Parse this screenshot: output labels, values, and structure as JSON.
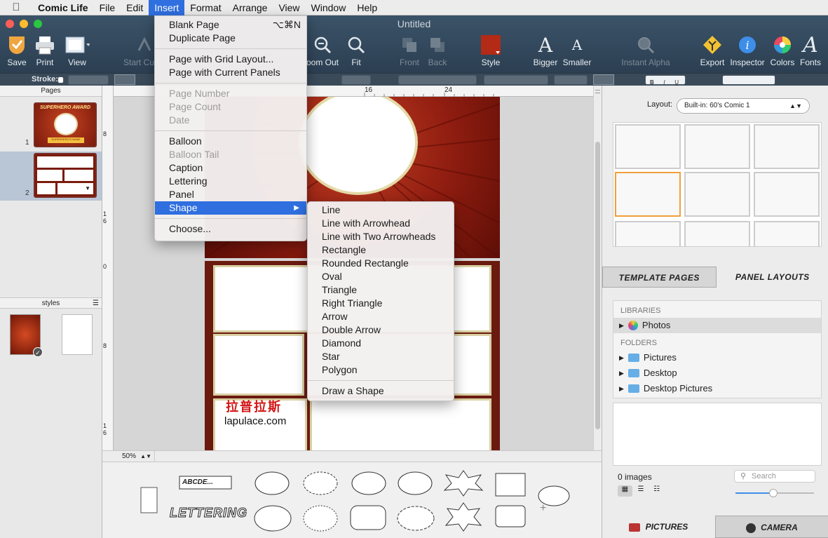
{
  "menubar": {
    "app": "Comic Life",
    "items": [
      "File",
      "Edit",
      "Insert",
      "Format",
      "Arrange",
      "View",
      "Window",
      "Help"
    ]
  },
  "window": {
    "title": "Untitled"
  },
  "toolbar": {
    "save": "Save",
    "print": "Print",
    "view": "View",
    "start": "Start Cu",
    "zoom_out": "oom Out",
    "fit": "Fit",
    "front": "Front",
    "back": "Back",
    "style": "Style",
    "bigger": "Bigger",
    "smaller": "Smaller",
    "instant_alpha": "Instant Alpha",
    "export": "Export",
    "inspector": "Inspector",
    "colors": "Colors",
    "fonts": "Fonts"
  },
  "format_bar": {
    "stroke_label": "Stroke:"
  },
  "sidebar": {
    "pages_header": "Pages",
    "pages": [
      {
        "num": "1",
        "title": "SUPERHERO AWARD",
        "sub": "SUPERHERO'S NAME"
      },
      {
        "num": "2"
      }
    ],
    "styles_header": "styles"
  },
  "ruler": {
    "h_ticks": [
      "16",
      "24"
    ],
    "v_ticks": [
      "8",
      "1\n6",
      "0",
      "8",
      "1\n6"
    ]
  },
  "zoom": {
    "value": "50%"
  },
  "watermark": {
    "cn": "拉普拉斯",
    "url": "lapulace.com"
  },
  "balloons": {
    "caption_text": "ABCDE...",
    "lettering_text": "LETTERING"
  },
  "insert_menu": {
    "groups": [
      [
        {
          "label": "Blank Page",
          "shortcut": "⌥⌘N"
        },
        {
          "label": "Duplicate Page"
        }
      ],
      [
        {
          "label": "Page with Grid Layout..."
        },
        {
          "label": "Page with Current Panels"
        }
      ],
      [
        {
          "label": "Page Number",
          "disabled": true
        },
        {
          "label": "Page Count",
          "disabled": true
        },
        {
          "label": "Date",
          "disabled": true
        }
      ],
      [
        {
          "label": "Balloon"
        },
        {
          "label": "Balloon Tail",
          "disabled": true
        },
        {
          "label": "Caption"
        },
        {
          "label": "Lettering"
        },
        {
          "label": "Panel"
        },
        {
          "label": "Shape",
          "highlighted": true,
          "submenu": true
        }
      ],
      [
        {
          "label": "Choose..."
        }
      ]
    ]
  },
  "shape_menu": {
    "items": [
      "Line",
      "Line with Arrowhead",
      "Line with Two Arrowheads",
      "Rectangle",
      "Rounded Rectangle",
      "Oval",
      "Triangle",
      "Right Triangle",
      "Arrow",
      "Double Arrow",
      "Diamond",
      "Star",
      "Polygon"
    ],
    "extra": "Draw a Shape"
  },
  "inspector": {
    "layout_label": "Layout:",
    "layout_value": "Built-in: 60's Comic 1",
    "tab_template": "TEMPLATE PAGES",
    "tab_panel": "PANEL LAYOUTS",
    "libraries_header": "LIBRARIES",
    "libraries": [
      "Photos"
    ],
    "folders_header": "FOLDERS",
    "folders": [
      "Pictures",
      "Desktop",
      "Desktop Pictures"
    ],
    "image_count": "0 images",
    "search_placeholder": "Search",
    "bottom_tab_pictures": "PICTURES",
    "bottom_tab_camera": "CAMERA"
  },
  "colors": {
    "accent": "#2f6fe0",
    "toolbar": "#34495c",
    "comic_red": "#a52a16"
  }
}
